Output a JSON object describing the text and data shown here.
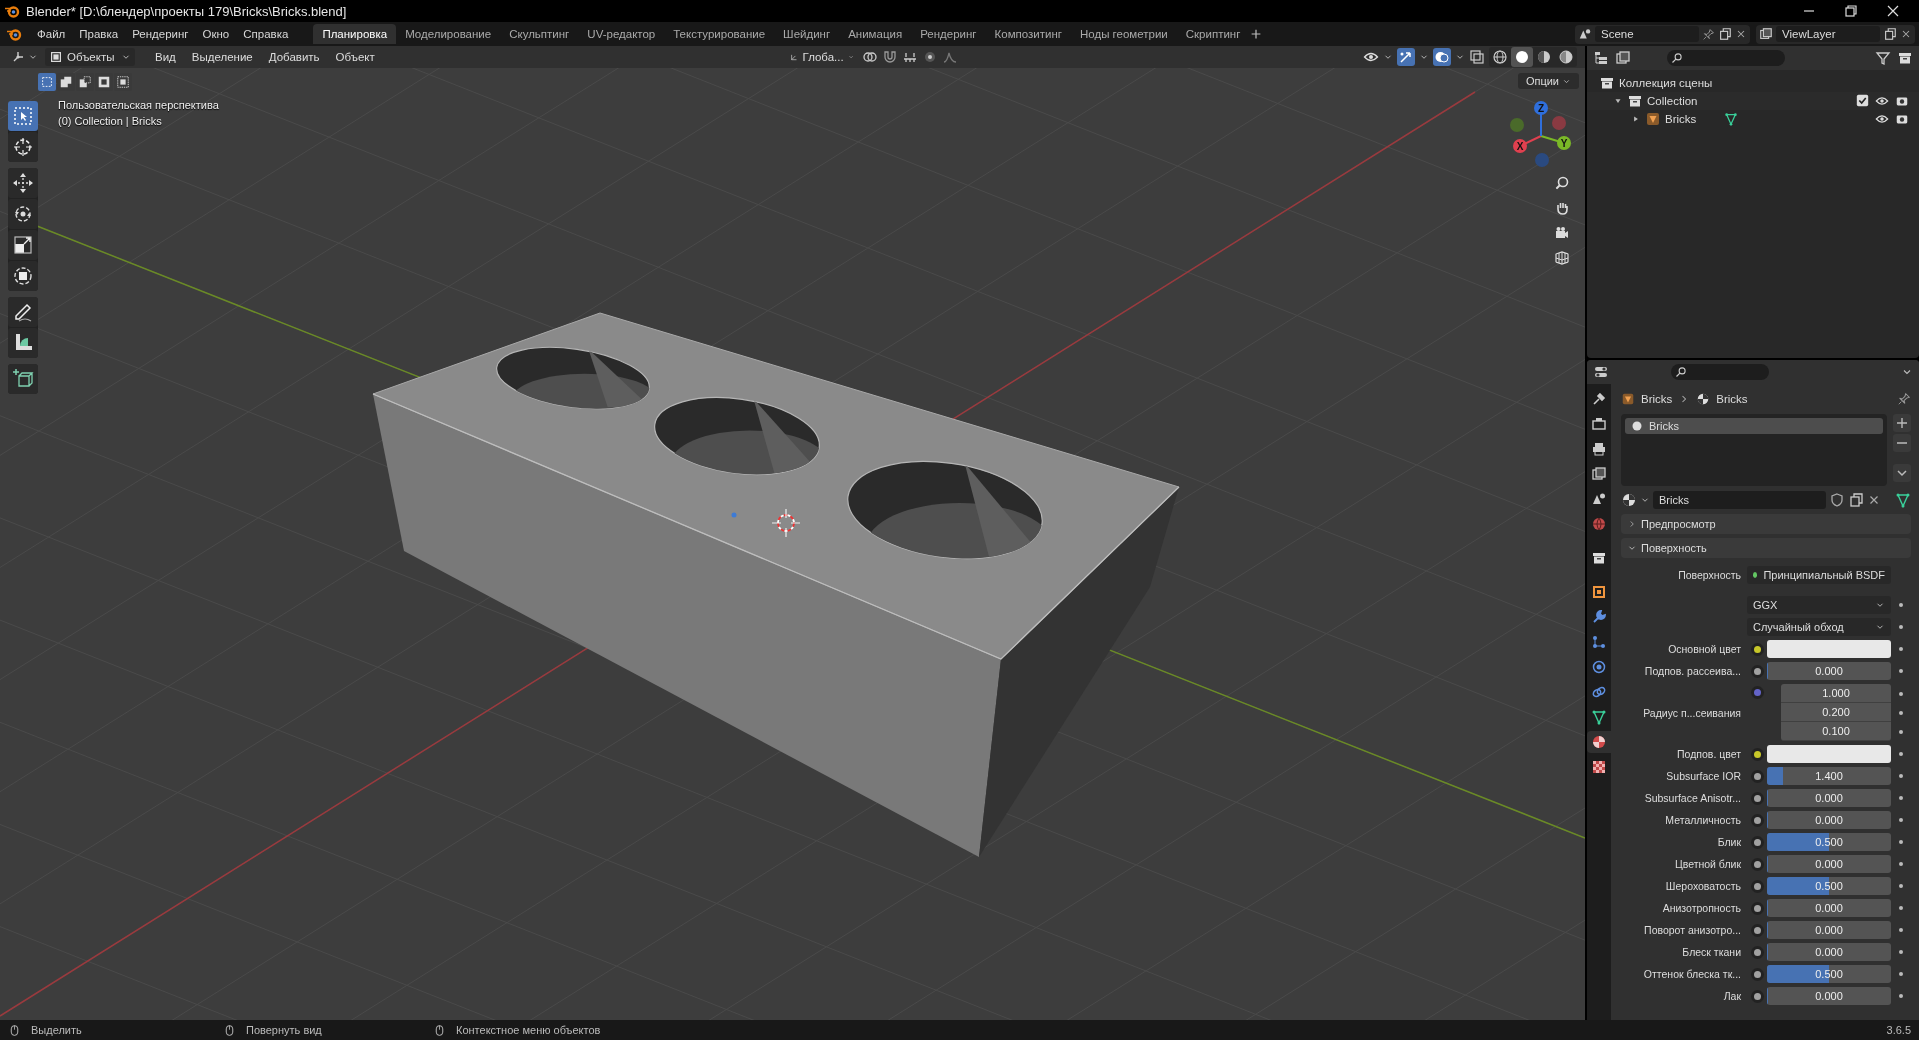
{
  "window": {
    "title": "Blender* [D:\\блендер\\проекты 179\\Bricks\\Bricks.blend]"
  },
  "menu": [
    "Файл",
    "Правка",
    "Рендеринг",
    "Окно",
    "Справка"
  ],
  "workspaces": [
    {
      "label": "Планировка",
      "selected": true
    },
    {
      "label": "Моделирование",
      "selected": false
    },
    {
      "label": "Скульптинг",
      "selected": false
    },
    {
      "label": "UV-редактор",
      "selected": false
    },
    {
      "label": "Текстурирование",
      "selected": false
    },
    {
      "label": "Шейдинг",
      "selected": false
    },
    {
      "label": "Анимация",
      "selected": false
    },
    {
      "label": "Рендеринг",
      "selected": false
    },
    {
      "label": "Композитинг",
      "selected": false
    },
    {
      "label": "Ноды геометрии",
      "selected": false
    },
    {
      "label": "Скриптинг",
      "selected": false
    }
  ],
  "scene": "Scene",
  "view_layer": "ViewLayer",
  "viewport": {
    "mode": "Объекты",
    "menus": [
      "Вид",
      "Выделение",
      "Добавить",
      "Объект"
    ],
    "orientation": "Глоба...",
    "options": "Опции",
    "shading": [
      {
        "kind": "wire",
        "selected": false
      },
      {
        "kind": "solid",
        "selected": true
      },
      {
        "kind": "material",
        "selected": false
      },
      {
        "kind": "rendered",
        "selected": false
      }
    ],
    "select_modes": [
      {
        "kind": "new",
        "selected": true
      },
      {
        "kind": "extend",
        "selected": false
      },
      {
        "kind": "subtract",
        "selected": false
      },
      {
        "kind": "invert",
        "selected": false
      },
      {
        "kind": "intersect",
        "selected": false
      }
    ],
    "overlay_text": [
      "Пользовательская перспектива",
      "(0) Collection | Bricks"
    ],
    "tool_groups": [
      [
        {
          "kind": "select",
          "selected": true
        },
        {
          "kind": "cursor",
          "selected": false
        }
      ],
      [
        {
          "kind": "move",
          "selected": false
        },
        {
          "kind": "rotate",
          "selected": false
        },
        {
          "kind": "scale",
          "selected": false
        },
        {
          "kind": "transform",
          "selected": false
        }
      ],
      [
        {
          "kind": "annotate",
          "selected": false
        },
        {
          "kind": "measure",
          "selected": false
        }
      ],
      [
        {
          "kind": "add_cube",
          "selected": false
        }
      ]
    ],
    "gizmo": {
      "x": "X",
      "y": "Y",
      "z": "Z"
    }
  },
  "outliner": {
    "items": [
      {
        "label": "Коллекция сцены",
        "children": [
          {
            "label": "Collection",
            "expanded": true,
            "checked": true,
            "children": [
              {
                "label": "Bricks",
                "expanded": false
              }
            ]
          }
        ]
      }
    ]
  },
  "properties": {
    "tabs": [
      {
        "kind": "tool",
        "selected": false
      },
      {
        "kind": "render",
        "selected": false
      },
      {
        "kind": "output",
        "selected": false
      },
      {
        "kind": "view_layer",
        "selected": false
      },
      {
        "kind": "scene",
        "selected": false
      },
      {
        "kind": "world",
        "selected": false
      },
      {
        "kind": "collection",
        "selected": false
      },
      {
        "kind": "object",
        "selected": false
      },
      {
        "kind": "modifiers",
        "selected": false
      },
      {
        "kind": "particles",
        "selected": false
      },
      {
        "kind": "physics",
        "selected": false
      },
      {
        "kind": "constraints",
        "selected": false
      },
      {
        "kind": "data",
        "selected": false
      },
      {
        "kind": "material",
        "selected": true
      },
      {
        "kind": "texture",
        "selected": false
      }
    ],
    "breadcrumb": [
      "Bricks",
      "Bricks"
    ],
    "slots": [
      {
        "label": "Bricks",
        "selected": true
      }
    ],
    "material": "Bricks",
    "panels": [
      {
        "label": "Предпросмотр",
        "expanded": false
      },
      {
        "label": "Поверхность",
        "expanded": true
      }
    ],
    "rows": [
      {
        "kind": "shader",
        "label": "Поверхность",
        "value": "Принципиальный BSDF"
      },
      {
        "kind": "dropdown",
        "value": "GGX"
      },
      {
        "kind": "dropdown",
        "value": "Случайный обход"
      },
      {
        "kind": "color",
        "label": "Основной цвет",
        "color": "#e8e8e8"
      },
      {
        "kind": "number",
        "label": "Подпов. рассеива...",
        "value": "0.000",
        "level": 0
      },
      {
        "kind": "vector",
        "label": "Радиус п...сеивания",
        "values": [
          "1.000",
          "0.200",
          "0.100"
        ]
      },
      {
        "kind": "color",
        "label": "Подпов. цвет",
        "color": "#e8e8e8"
      },
      {
        "kind": "number",
        "label": "Subsurface IOR",
        "value": "1.400",
        "level": 0.13
      },
      {
        "kind": "number",
        "label": "Subsurface Anisotr...",
        "value": "0.000",
        "level": 0
      },
      {
        "kind": "number",
        "label": "Металличность",
        "value": "0.000",
        "level": 0
      },
      {
        "kind": "number",
        "label": "Блик",
        "value": "0.500",
        "level": 0.5
      },
      {
        "kind": "number",
        "label": "Цветной блик",
        "value": "0.000",
        "level": 0
      },
      {
        "kind": "number",
        "label": "Шероховатость",
        "value": "0.500",
        "level": 0.5
      },
      {
        "kind": "number",
        "label": "Анизотропность",
        "value": "0.000",
        "level": 0
      },
      {
        "kind": "number",
        "label": "Поворот анизотро...",
        "value": "0.000",
        "level": 0
      },
      {
        "kind": "number",
        "label": "Блеск ткани",
        "value": "0.000",
        "level": 0
      },
      {
        "kind": "number",
        "label": "Оттенок блеска тк...",
        "value": "0.500",
        "level": 0.5
      },
      {
        "kind": "number",
        "label": "Лак",
        "value": "0.000",
        "level": 0
      }
    ]
  },
  "status_bar": {
    "hints": [
      "Выделить",
      "Повернуть вид",
      "Контекстное меню объектов"
    ],
    "version": "3.6.5"
  }
}
